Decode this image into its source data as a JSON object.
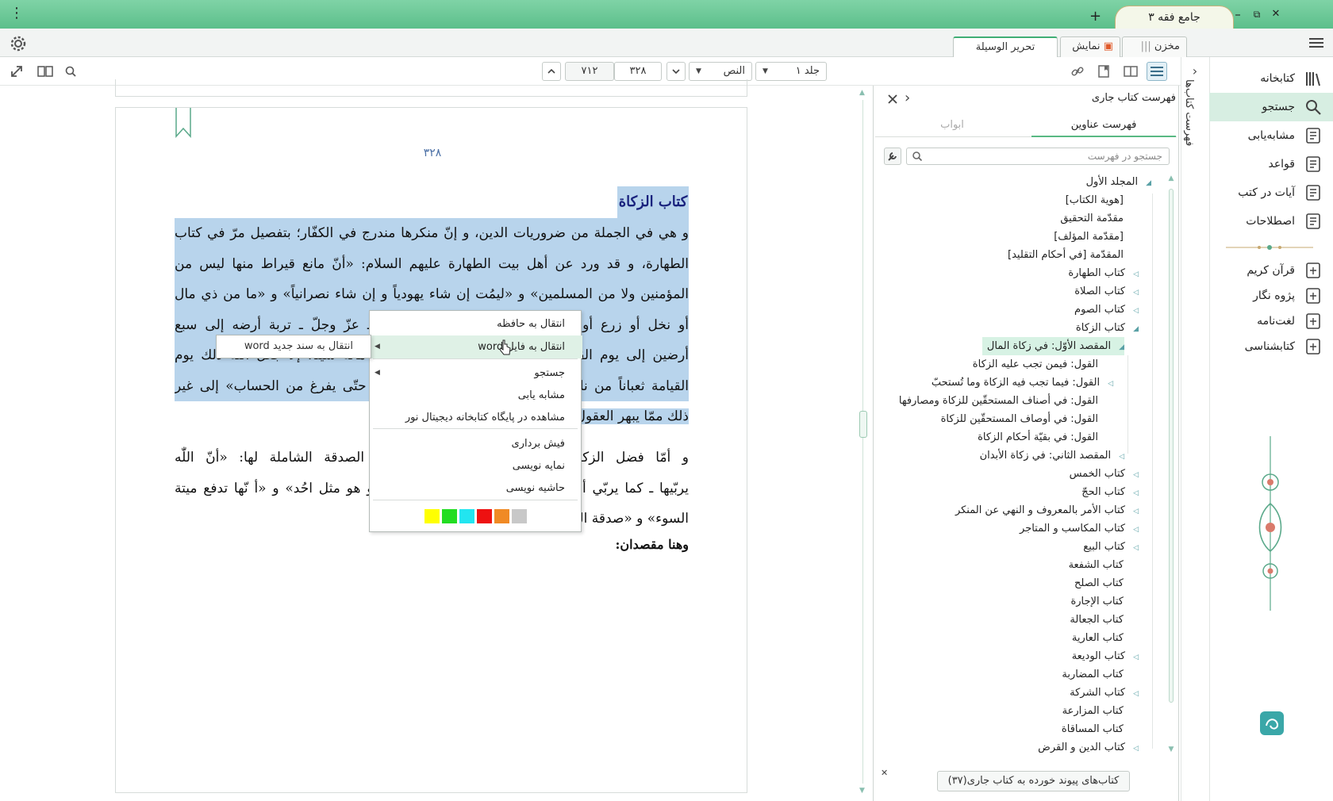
{
  "titlebar": {
    "tab_title": "جامع فقه ۳",
    "help": "؟",
    "add": "+",
    "min": "–",
    "max": "⧉",
    "close": "✕",
    "menu": "⋮"
  },
  "tabs": {
    "makhzan": "مخزن",
    "namayesh": "نمایش",
    "book_tab": "تحریر الوسيلة"
  },
  "toolbar": {
    "volume": "جلد ۱",
    "view_mode": "النص",
    "page_current": "۳۲۸",
    "page_total": "۷۱۲"
  },
  "nav": {
    "items": [
      {
        "label": "کتابخانه",
        "icon": "library-icon"
      },
      {
        "label": "جستجو",
        "icon": "search-icon"
      },
      {
        "label": "مشابه‌یابی",
        "icon": "similar-icon"
      },
      {
        "label": "قواعد",
        "icon": "rules-icon"
      },
      {
        "label": "آیات در کتب",
        "icon": "verses-icon"
      },
      {
        "label": "اصطلاحات",
        "icon": "terms-icon"
      }
    ],
    "tools": [
      {
        "label": "قرآن کریم",
        "icon": "quran-icon"
      },
      {
        "label": "پژوه نگار",
        "icon": "note-icon"
      },
      {
        "label": "لغت‌نامه",
        "icon": "dictionary-icon"
      },
      {
        "label": "کتابشناسی",
        "icon": "bibliography-icon"
      }
    ],
    "side_label": "فهرست کتاب‌ها"
  },
  "toc": {
    "title": "فهرست کتاب جاری",
    "tab_active": "فهرست عناوین",
    "tab_inactive": "ابواب",
    "search_placeholder": "جستجو در فهرست",
    "nodes": [
      {
        "label": "المجلد الأول",
        "level": 0,
        "arrow": "down"
      },
      {
        "label": "[هوية الكتاب]",
        "level": 1,
        "arrow": ""
      },
      {
        "label": "مقدّمة التحقيق",
        "level": 1,
        "arrow": ""
      },
      {
        "label": "[مقدّمة المؤلف]",
        "level": 1,
        "arrow": ""
      },
      {
        "label": "المقدّمة [في أحكام التقليد]",
        "level": 1,
        "arrow": ""
      },
      {
        "label": "كتاب الطهارة",
        "level": 1,
        "arrow": "right"
      },
      {
        "label": "كتاب الصلاة",
        "level": 1,
        "arrow": "right"
      },
      {
        "label": "كتاب الصوم",
        "level": 1,
        "arrow": "right"
      },
      {
        "label": "كتاب الزكاة",
        "level": 1,
        "arrow": "down"
      },
      {
        "label": "المقصد الأوّل: في زكاة المال",
        "level": 2,
        "arrow": "down",
        "selected": true
      },
      {
        "label": "القول: فيمن تجب عليه الزكاة",
        "level": 3,
        "arrow": ""
      },
      {
        "label": "القول: فيما تجب فيه الزكاة وما تُستحبّ",
        "level": 3,
        "arrow": "right"
      },
      {
        "label": "القول: في أصناف المستحقّين للزكاة ومصارفها",
        "level": 3,
        "arrow": ""
      },
      {
        "label": "القول: في أوصاف المستحقّين للزكاة",
        "level": 3,
        "arrow": ""
      },
      {
        "label": "القول: في بقيّة أحكام الزكاة",
        "level": 3,
        "arrow": ""
      },
      {
        "label": "المقصد الثاني: في زكاة الأبدان",
        "level": 2,
        "arrow": "right"
      },
      {
        "label": "كتاب الخمس",
        "level": 1,
        "arrow": "right"
      },
      {
        "label": "كتاب الحجّ",
        "level": 1,
        "arrow": "right"
      },
      {
        "label": "كتاب الأمر بالمعروف و النهي عن المنكر",
        "level": 1,
        "arrow": "right"
      },
      {
        "label": "كتاب المكاسب و المتاجر",
        "level": 1,
        "arrow": "right"
      },
      {
        "label": "كتاب البيع",
        "level": 1,
        "arrow": "right"
      },
      {
        "label": "كتاب الشفعة",
        "level": 1,
        "arrow": ""
      },
      {
        "label": "كتاب الصلح",
        "level": 1,
        "arrow": ""
      },
      {
        "label": "كتاب الإجارة",
        "level": 1,
        "arrow": ""
      },
      {
        "label": "كتاب الجعالة",
        "level": 1,
        "arrow": ""
      },
      {
        "label": "كتاب العارية",
        "level": 1,
        "arrow": ""
      },
      {
        "label": "كتاب الوديعة",
        "level": 1,
        "arrow": "right"
      },
      {
        "label": "كتاب المضاربة",
        "level": 1,
        "arrow": ""
      },
      {
        "label": "كتاب الشركة",
        "level": 1,
        "arrow": "right"
      },
      {
        "label": "كتاب المزارعة",
        "level": 1,
        "arrow": ""
      },
      {
        "label": "كتاب المساقاة",
        "level": 1,
        "arrow": ""
      },
      {
        "label": "كتاب الدين و القرض",
        "level": 1,
        "arrow": "right"
      }
    ],
    "linked_books": "کتاب‌های پیوند خورده به کتاب جاری(۳۷)"
  },
  "doc": {
    "page_number": "۳۲۸",
    "heading": "كتاب الزكاة",
    "lines": [
      "و هي في الجملة من ضروريات الدين، و إنّ منكرها مندرج في الكفّار؛ بتفصيل مرّ في كتاب",
      "الطهارة، و قد ورد عن أهل بيت الطهارة عليهم السلام: «أنّ مانع قيراط منها ليس من",
      "المؤمنين ولا من المسلمين» و «ليمُت إن شاء يهودياً و إن شاء نصرانياً» و «ما من ذي مال",
      "أو نخل أو زرع أو كرم يمنع زكاة ماله إلّا قلّده اللّٰه ـ عزّ وجلّ ـ تربة أرضه إلى سبع",
      "أرضين إلى يوم القيامة» و «ما من عبد منع من زكاة ماله شيئاً، إلّا جعل اللّٰه ذلك يوم",
      "القيامة ثعباناً من نار مطوّقاً في عنقه، ينهش من لحمه حتّى يفرغ من الحساب» إلى غير",
      "ذلك ممّا يبهر العقول"
    ],
    "para2": [
      "و أمّا فضل الزكاة فعظيم، و قد ورد في فضل الصدقة الشاملة لها: «أنّ اللّٰه",
      "يربّيها ـ كما يربّي أحدكم ولده ـ حتّى يلقاه يوم القيامة و هو مثل احُد» و «أ نّها تدفع ميتة",
      "السوء» و «صدقة السرّ تطفئ غضب الربّ»"
    ],
    "subheading": "وهنا مقصدان:"
  },
  "context_menu": {
    "items": [
      {
        "label": "انتقال به حافظه",
        "sub": false
      },
      {
        "label": "انتقال به فایل word",
        "sub": true
      },
      {
        "label": "جستجو",
        "sub": true
      },
      {
        "label": "مشابه یابی",
        "sub": false
      },
      {
        "label": "مشاهده در پایگاه کتابخانه دیجیتال نور",
        "sub": false
      },
      {
        "label": "فیش برداری",
        "sub": false
      },
      {
        "label": "نمایه نویسی",
        "sub": false
      },
      {
        "label": "حاشیه نویسی",
        "sub": false
      }
    ],
    "colors": [
      "#ffff00",
      "#22dd22",
      "#22e5f0",
      "#ee1111",
      "#f08a25",
      "#c8c8c8"
    ],
    "submenu": "انتقال به سند جدید word"
  }
}
